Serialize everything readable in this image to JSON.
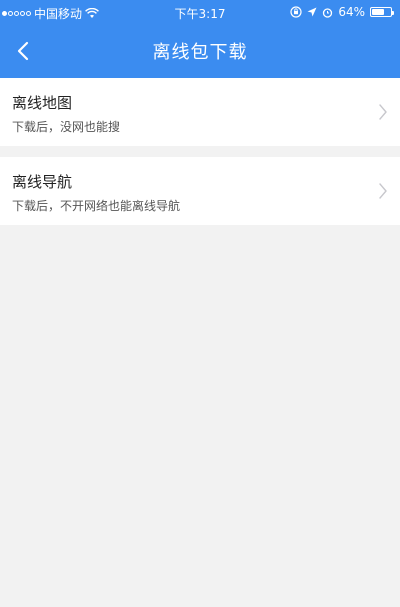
{
  "status_bar": {
    "carrier": "中国移动",
    "time": "下午3:17",
    "battery": "64%",
    "battery_level": 0.64,
    "icons": [
      "signal-dots-icon",
      "wifi-icon",
      "orientation-lock-icon",
      "location-arrow-icon",
      "alarm-icon",
      "battery-icon"
    ]
  },
  "nav": {
    "title": "离线包下载",
    "back_icon": "chevron-left-icon"
  },
  "items": [
    {
      "title": "离线地图",
      "subtitle": "下载后，没网也能搜",
      "icon": "chevron-right-icon"
    },
    {
      "title": "离线导航",
      "subtitle": "下载后，不开网络也能离线导航",
      "icon": "chevron-right-icon"
    }
  ],
  "colors": {
    "header_bg": "#3b8cf0",
    "page_bg": "#f2f2f2",
    "card_bg": "#ffffff",
    "chevron": "#c7c7cc"
  }
}
